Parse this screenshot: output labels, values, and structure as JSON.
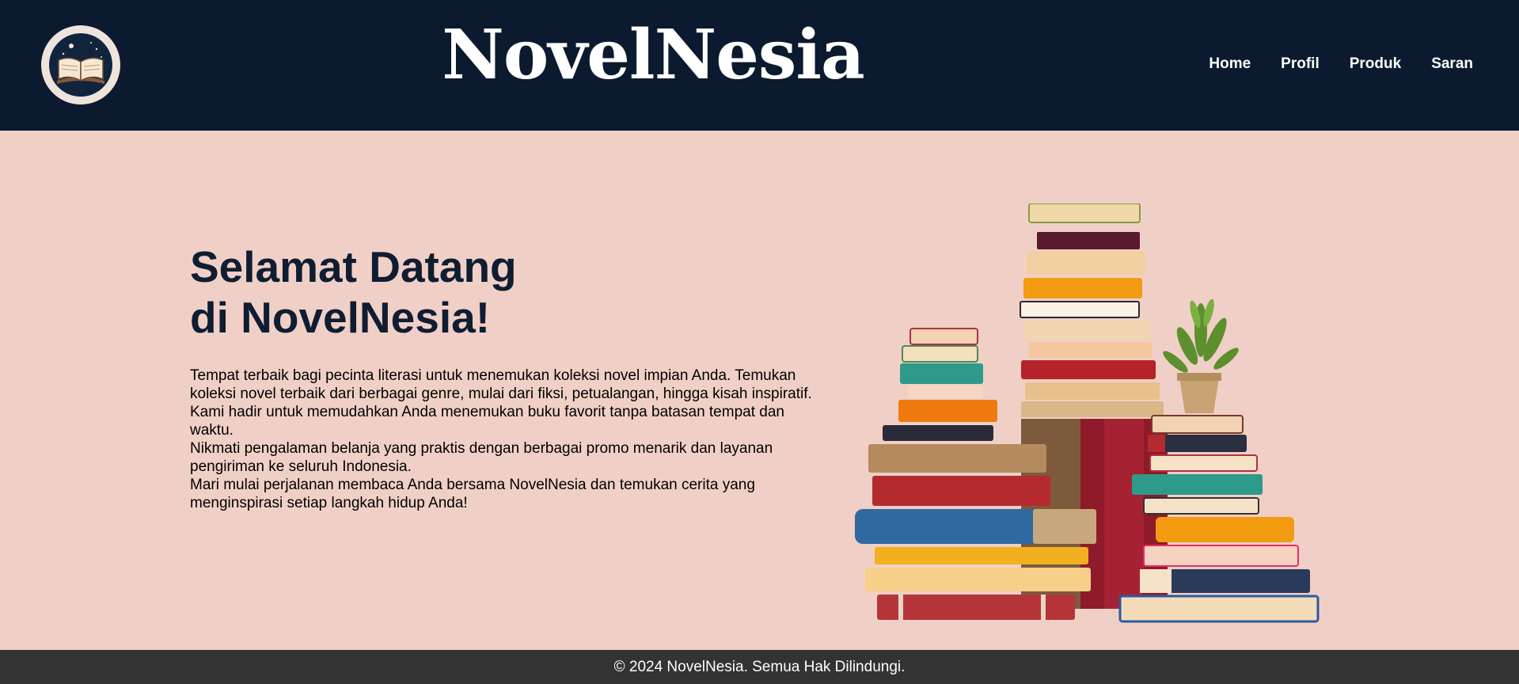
{
  "header": {
    "logo_icon": "open-book-logo-icon",
    "brand": "NovelNesia",
    "nav": [
      {
        "label": "Home"
      },
      {
        "label": "Profil"
      },
      {
        "label": "Produk"
      },
      {
        "label": "Saran"
      }
    ]
  },
  "hero": {
    "title_line1": "Selamat Datang",
    "title_line2": "di NovelNesia!",
    "paragraph1": "Tempat terbaik bagi pecinta literasi untuk menemukan koleksi novel impian Anda. Temukan koleksi novel terbaik dari berbagai genre, mulai dari fiksi, petualangan, hingga kisah inspiratif. Kami hadir untuk memudahkan Anda menemukan buku favorit tanpa batasan tempat dan waktu.",
    "paragraph2": "Nikmati pengalaman belanja yang praktis dengan berbagai promo menarik dan layanan pengiriman ke seluruh Indonesia.",
    "paragraph3": "Mari mulai perjalanan membaca Anda bersama NovelNesia dan temukan cerita yang menginspirasi setiap langkah hidup Anda!",
    "image_icon": "book-stack-illustration"
  },
  "footer": {
    "text": "© 2024 NovelNesia. Semua Hak Dilindungi."
  },
  "colors": {
    "header_bg": "#0b1a2e",
    "page_bg": "#f0d0c6",
    "footer_bg": "#333333",
    "title_color": "#0f1d33"
  }
}
